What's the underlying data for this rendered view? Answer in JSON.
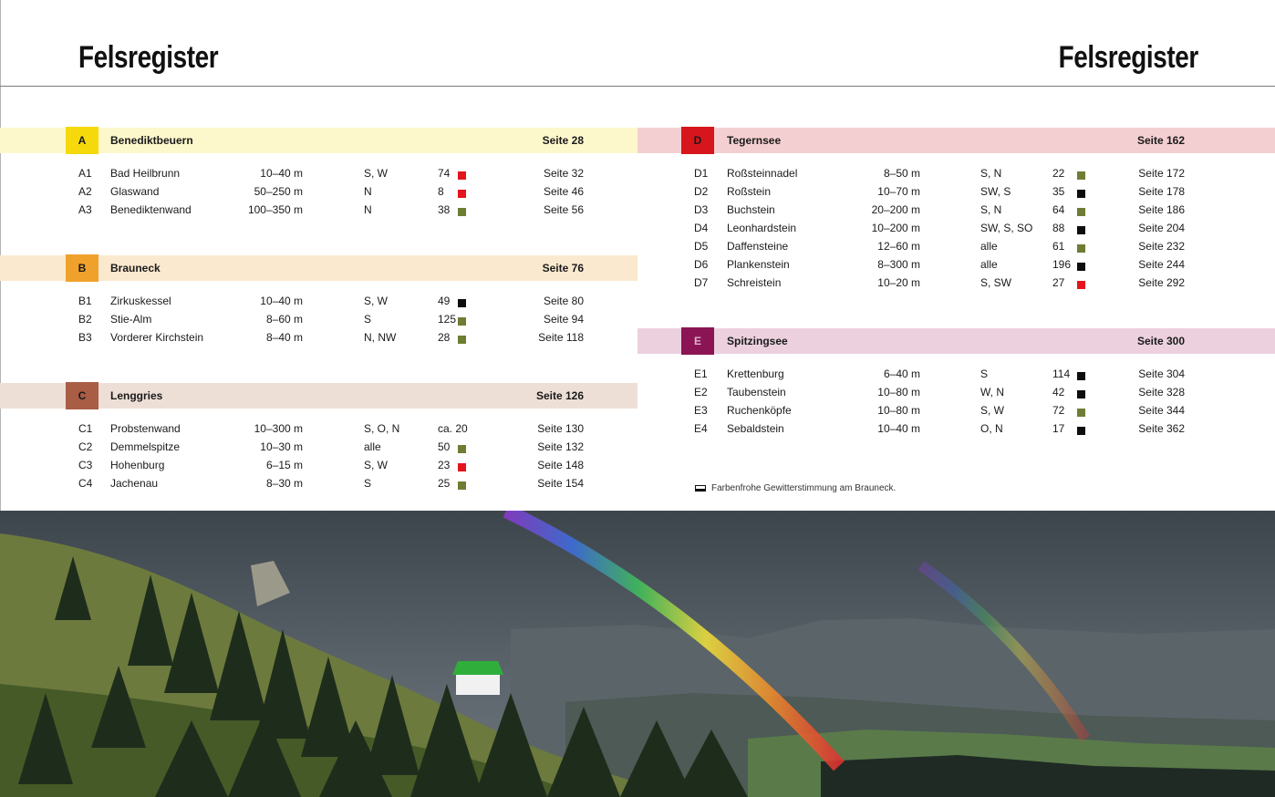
{
  "header": {
    "title_left": "Felsregister",
    "title_right": "Felsregister"
  },
  "colors": {
    "blue": "#1a73b8",
    "red": "#e3141c",
    "olive": "#6e7d34",
    "black": "#0d0d0d",
    "A": {
      "box": "#f5d90a",
      "bar": "#fdf7cc"
    },
    "B": {
      "box": "#f0a12c",
      "bar": "#fbe9cf"
    },
    "C": {
      "box": "#a85d44",
      "bar": "#eedfd6"
    },
    "D": {
      "box": "#d7151c",
      "bar": "#f4cfd1"
    },
    "E": {
      "box": "#8b1455",
      "bar": "#ecd0de"
    }
  },
  "sections": [
    {
      "letter": "A",
      "name": "Benediktbeuern",
      "page": "Seite 28",
      "rows": [
        {
          "id": "A1",
          "name": "Bad Heilbrunn",
          "hoehe": "10–40 m",
          "richtung": "S, W",
          "anzahl": "74",
          "marks": [
            "blue",
            "red"
          ],
          "page": "Seite 32"
        },
        {
          "id": "A2",
          "name": "Glaswand",
          "hoehe": "50–250 m",
          "richtung": "N",
          "anzahl": "8",
          "marks": [
            "",
            "red"
          ],
          "page": "Seite 46"
        },
        {
          "id": "A3",
          "name": "Benediktenwand",
          "hoehe": "100–350 m",
          "richtung": "N",
          "anzahl": "38",
          "marks": [
            "blue",
            "red",
            "olive"
          ],
          "page": "Seite 56"
        }
      ]
    },
    {
      "letter": "B",
      "name": "Brauneck",
      "page": "Seite 76",
      "rows": [
        {
          "id": "B1",
          "name": "Zirkuskessel",
          "hoehe": "10–40 m",
          "richtung": "S, W",
          "anzahl": "49",
          "marks": [
            "blue",
            "red",
            "olive",
            "black"
          ],
          "page": "Seite 80"
        },
        {
          "id": "B2",
          "name": "Stie-Alm",
          "hoehe": "8–60 m",
          "richtung": "S",
          "anzahl": "125",
          "marks": [
            "blue",
            "red",
            "olive"
          ],
          "page": "Seite 94"
        },
        {
          "id": "B3",
          "name": "Vorderer Kirchstein",
          "hoehe": "8–40 m",
          "richtung": "N, NW",
          "anzahl": "28",
          "marks": [
            "blue",
            "red",
            "olive"
          ],
          "page": "Seite 118"
        }
      ]
    },
    {
      "letter": "C",
      "name": "Lenggries",
      "page": "Seite 126",
      "rows": [
        {
          "id": "C1",
          "name": "Probstenwand",
          "hoehe": "10–300 m",
          "richtung": "S, O, N",
          "anzahl": "ca. 20",
          "marks": [],
          "page": "Seite 130"
        },
        {
          "id": "C2",
          "name": "Demmelspitze",
          "hoehe": "10–30 m",
          "richtung": "alle",
          "anzahl": "50",
          "marks": [
            "",
            "red",
            "olive"
          ],
          "page": "Seite 132"
        },
        {
          "id": "C3",
          "name": "Hohenburg",
          "hoehe": "6–15 m",
          "richtung": "S, W",
          "anzahl": "23",
          "marks": [
            "blue",
            "red"
          ],
          "page": "Seite 148"
        },
        {
          "id": "C4",
          "name": "Jachenau",
          "hoehe": "8–30 m",
          "richtung": "S",
          "anzahl": "25",
          "marks": [
            "",
            "red",
            "olive"
          ],
          "page": "Seite 154"
        }
      ]
    },
    {
      "letter": "D",
      "name": "Tegernsee",
      "page": "Seite 162",
      "rows": [
        {
          "id": "D1",
          "name": "Roßsteinnadel",
          "hoehe": "8–50 m",
          "richtung": "S, N",
          "anzahl": "22",
          "marks": [
            "blue",
            "red",
            "olive"
          ],
          "page": "Seite 172"
        },
        {
          "id": "D2",
          "name": "Roßstein",
          "hoehe": "10–70 m",
          "richtung": "SW, S",
          "anzahl": "35",
          "marks": [
            "blue",
            "red",
            "olive",
            "black"
          ],
          "page": "Seite 178"
        },
        {
          "id": "D3",
          "name": "Buchstein",
          "hoehe": "20–200 m",
          "richtung": "S, N",
          "anzahl": "64",
          "marks": [
            "blue",
            "red",
            "olive"
          ],
          "page": "Seite 186"
        },
        {
          "id": "D4",
          "name": "Leonhardstein",
          "hoehe": "10–200 m",
          "richtung": "SW, S, SO",
          "anzahl": "88",
          "marks": [
            "",
            "red",
            "olive",
            "black"
          ],
          "page": "Seite 204"
        },
        {
          "id": "D5",
          "name": "Daffensteine",
          "hoehe": "12–60 m",
          "richtung": "alle",
          "anzahl": "61",
          "marks": [
            "blue",
            "red",
            "olive"
          ],
          "page": "Seite 232"
        },
        {
          "id": "D6",
          "name": "Plankenstein",
          "hoehe": "8–300 m",
          "richtung": "alle",
          "anzahl": "196",
          "marks": [
            "blue",
            "red",
            "olive",
            "black"
          ],
          "page": "Seite 244"
        },
        {
          "id": "D7",
          "name": "Schreistein",
          "hoehe": "10–20 m",
          "richtung": "S, SW",
          "anzahl": "27",
          "marks": [
            "blue",
            "red"
          ],
          "page": "Seite 292"
        }
      ]
    },
    {
      "letter": "E",
      "name": "Spitzingsee",
      "page": "Seite 300",
      "rows": [
        {
          "id": "E1",
          "name": "Krettenburg",
          "hoehe": "6–40 m",
          "richtung": "S",
          "anzahl": "114",
          "marks": [
            "blue",
            "red",
            "olive",
            "black"
          ],
          "page": "Seite 304"
        },
        {
          "id": "E2",
          "name": "Taubenstein",
          "hoehe": "10–80 m",
          "richtung": "W, N",
          "anzahl": "42",
          "marks": [
            "blue",
            "red",
            "olive",
            "black"
          ],
          "page": "Seite 328"
        },
        {
          "id": "E3",
          "name": "Ruchenköpfe",
          "hoehe": "10–80 m",
          "richtung": "S, W",
          "anzahl": "72",
          "marks": [
            "blue",
            "red",
            "olive"
          ],
          "page": "Seite 344"
        },
        {
          "id": "E4",
          "name": "Sebaldstein",
          "hoehe": "10–40 m",
          "richtung": "O, N",
          "anzahl": "17",
          "marks": [
            "",
            "red",
            "olive",
            "black"
          ],
          "page": "Seite 362"
        }
      ]
    }
  ],
  "caption": "Farbenfrohe Gewitterstimmung am Brauneck."
}
